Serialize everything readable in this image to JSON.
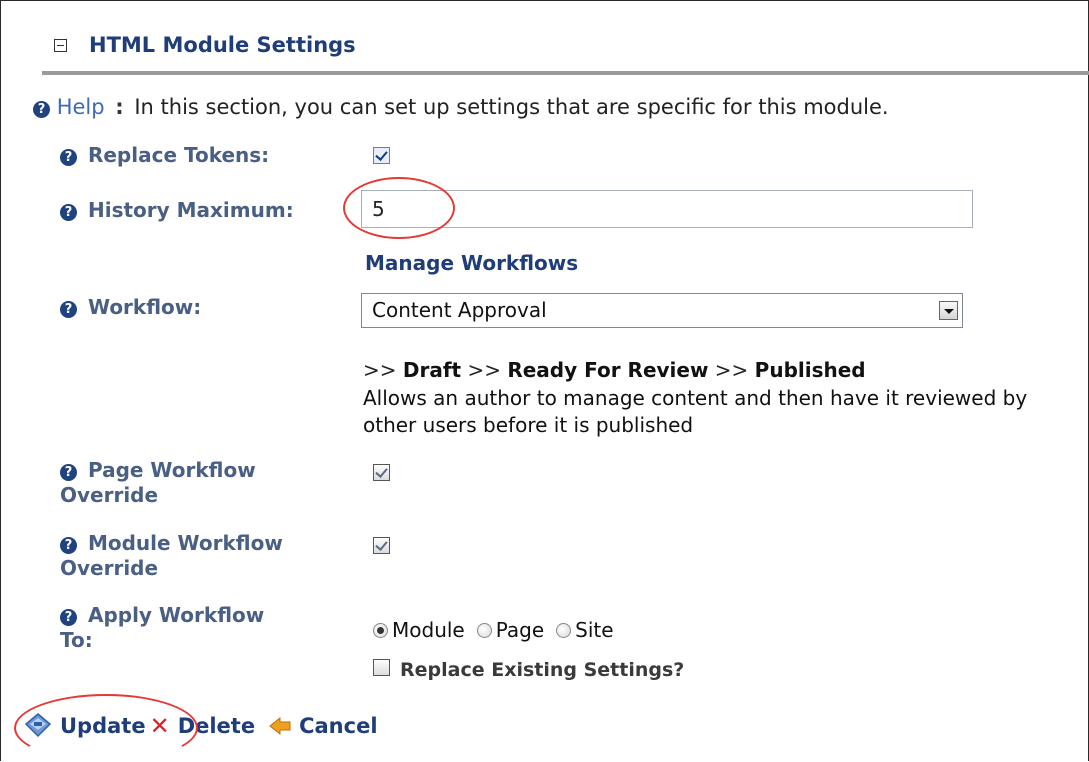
{
  "section": {
    "title": "HTML Module Settings",
    "collapse_icon": "collapse-icon"
  },
  "help": {
    "link": "Help",
    "colon": ":",
    "text": "In this section, you can set up settings that are specific for this module."
  },
  "fields": {
    "replace_tokens": {
      "label": "Replace Tokens:",
      "checked": true
    },
    "history_maximum": {
      "label": "History Maximum:",
      "value": "5"
    },
    "manage_workflows": "Manage Workflows",
    "workflow": {
      "label": "Workflow:",
      "selected": "Content Approval",
      "steps_prefix": ">>",
      "step1": "Draft",
      "step2": "Ready For Review",
      "step3": "Published",
      "sep": ">>",
      "description": "Allows an author to manage content and then have it reviewed by other users before it is published"
    },
    "page_workflow_override": {
      "label_line1": "Page Workflow",
      "label_line2": "Override",
      "checked": true
    },
    "module_workflow_override": {
      "label_line1": "Module Workflow",
      "label_line2": "Override",
      "checked": true
    },
    "apply_workflow_to": {
      "label_line1": "Apply Workflow",
      "label_line2": "To:",
      "options": [
        "Module",
        "Page",
        "Site"
      ],
      "selected": "Module"
    },
    "replace_existing": {
      "label": "Replace Existing Settings?",
      "checked": false
    }
  },
  "actions": {
    "update": "Update",
    "delete": "Delete",
    "cancel": "Cancel"
  },
  "colors": {
    "title": "#1f3d78",
    "label": "#4a5f84",
    "annotation": "#e53935"
  }
}
